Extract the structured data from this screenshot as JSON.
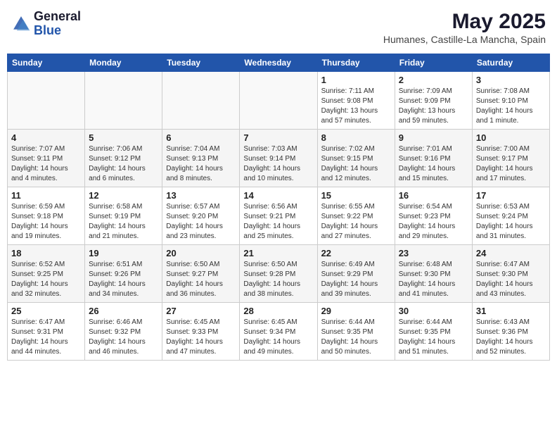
{
  "header": {
    "logo_general": "General",
    "logo_blue": "Blue",
    "month_title": "May 2025",
    "location": "Humanes, Castille-La Mancha, Spain"
  },
  "days_of_week": [
    "Sunday",
    "Monday",
    "Tuesday",
    "Wednesday",
    "Thursday",
    "Friday",
    "Saturday"
  ],
  "weeks": [
    {
      "row_class": "row-odd",
      "days": [
        {
          "num": "",
          "info": "",
          "empty": true
        },
        {
          "num": "",
          "info": "",
          "empty": true
        },
        {
          "num": "",
          "info": "",
          "empty": true
        },
        {
          "num": "",
          "info": "",
          "empty": true
        },
        {
          "num": "1",
          "info": "Sunrise: 7:11 AM\nSunset: 9:08 PM\nDaylight: 13 hours and 57 minutes.",
          "empty": false
        },
        {
          "num": "2",
          "info": "Sunrise: 7:09 AM\nSunset: 9:09 PM\nDaylight: 13 hours and 59 minutes.",
          "empty": false
        },
        {
          "num": "3",
          "info": "Sunrise: 7:08 AM\nSunset: 9:10 PM\nDaylight: 14 hours and 1 minute.",
          "empty": false
        }
      ]
    },
    {
      "row_class": "row-even",
      "days": [
        {
          "num": "4",
          "info": "Sunrise: 7:07 AM\nSunset: 9:11 PM\nDaylight: 14 hours and 4 minutes.",
          "empty": false
        },
        {
          "num": "5",
          "info": "Sunrise: 7:06 AM\nSunset: 9:12 PM\nDaylight: 14 hours and 6 minutes.",
          "empty": false
        },
        {
          "num": "6",
          "info": "Sunrise: 7:04 AM\nSunset: 9:13 PM\nDaylight: 14 hours and 8 minutes.",
          "empty": false
        },
        {
          "num": "7",
          "info": "Sunrise: 7:03 AM\nSunset: 9:14 PM\nDaylight: 14 hours and 10 minutes.",
          "empty": false
        },
        {
          "num": "8",
          "info": "Sunrise: 7:02 AM\nSunset: 9:15 PM\nDaylight: 14 hours and 12 minutes.",
          "empty": false
        },
        {
          "num": "9",
          "info": "Sunrise: 7:01 AM\nSunset: 9:16 PM\nDaylight: 14 hours and 15 minutes.",
          "empty": false
        },
        {
          "num": "10",
          "info": "Sunrise: 7:00 AM\nSunset: 9:17 PM\nDaylight: 14 hours and 17 minutes.",
          "empty": false
        }
      ]
    },
    {
      "row_class": "row-odd",
      "days": [
        {
          "num": "11",
          "info": "Sunrise: 6:59 AM\nSunset: 9:18 PM\nDaylight: 14 hours and 19 minutes.",
          "empty": false
        },
        {
          "num": "12",
          "info": "Sunrise: 6:58 AM\nSunset: 9:19 PM\nDaylight: 14 hours and 21 minutes.",
          "empty": false
        },
        {
          "num": "13",
          "info": "Sunrise: 6:57 AM\nSunset: 9:20 PM\nDaylight: 14 hours and 23 minutes.",
          "empty": false
        },
        {
          "num": "14",
          "info": "Sunrise: 6:56 AM\nSunset: 9:21 PM\nDaylight: 14 hours and 25 minutes.",
          "empty": false
        },
        {
          "num": "15",
          "info": "Sunrise: 6:55 AM\nSunset: 9:22 PM\nDaylight: 14 hours and 27 minutes.",
          "empty": false
        },
        {
          "num": "16",
          "info": "Sunrise: 6:54 AM\nSunset: 9:23 PM\nDaylight: 14 hours and 29 minutes.",
          "empty": false
        },
        {
          "num": "17",
          "info": "Sunrise: 6:53 AM\nSunset: 9:24 PM\nDaylight: 14 hours and 31 minutes.",
          "empty": false
        }
      ]
    },
    {
      "row_class": "row-even",
      "days": [
        {
          "num": "18",
          "info": "Sunrise: 6:52 AM\nSunset: 9:25 PM\nDaylight: 14 hours and 32 minutes.",
          "empty": false
        },
        {
          "num": "19",
          "info": "Sunrise: 6:51 AM\nSunset: 9:26 PM\nDaylight: 14 hours and 34 minutes.",
          "empty": false
        },
        {
          "num": "20",
          "info": "Sunrise: 6:50 AM\nSunset: 9:27 PM\nDaylight: 14 hours and 36 minutes.",
          "empty": false
        },
        {
          "num": "21",
          "info": "Sunrise: 6:50 AM\nSunset: 9:28 PM\nDaylight: 14 hours and 38 minutes.",
          "empty": false
        },
        {
          "num": "22",
          "info": "Sunrise: 6:49 AM\nSunset: 9:29 PM\nDaylight: 14 hours and 39 minutes.",
          "empty": false
        },
        {
          "num": "23",
          "info": "Sunrise: 6:48 AM\nSunset: 9:30 PM\nDaylight: 14 hours and 41 minutes.",
          "empty": false
        },
        {
          "num": "24",
          "info": "Sunrise: 6:47 AM\nSunset: 9:30 PM\nDaylight: 14 hours and 43 minutes.",
          "empty": false
        }
      ]
    },
    {
      "row_class": "row-odd",
      "days": [
        {
          "num": "25",
          "info": "Sunrise: 6:47 AM\nSunset: 9:31 PM\nDaylight: 14 hours and 44 minutes.",
          "empty": false
        },
        {
          "num": "26",
          "info": "Sunrise: 6:46 AM\nSunset: 9:32 PM\nDaylight: 14 hours and 46 minutes.",
          "empty": false
        },
        {
          "num": "27",
          "info": "Sunrise: 6:45 AM\nSunset: 9:33 PM\nDaylight: 14 hours and 47 minutes.",
          "empty": false
        },
        {
          "num": "28",
          "info": "Sunrise: 6:45 AM\nSunset: 9:34 PM\nDaylight: 14 hours and 49 minutes.",
          "empty": false
        },
        {
          "num": "29",
          "info": "Sunrise: 6:44 AM\nSunset: 9:35 PM\nDaylight: 14 hours and 50 minutes.",
          "empty": false
        },
        {
          "num": "30",
          "info": "Sunrise: 6:44 AM\nSunset: 9:35 PM\nDaylight: 14 hours and 51 minutes.",
          "empty": false
        },
        {
          "num": "31",
          "info": "Sunrise: 6:43 AM\nSunset: 9:36 PM\nDaylight: 14 hours and 52 minutes.",
          "empty": false
        }
      ]
    }
  ]
}
